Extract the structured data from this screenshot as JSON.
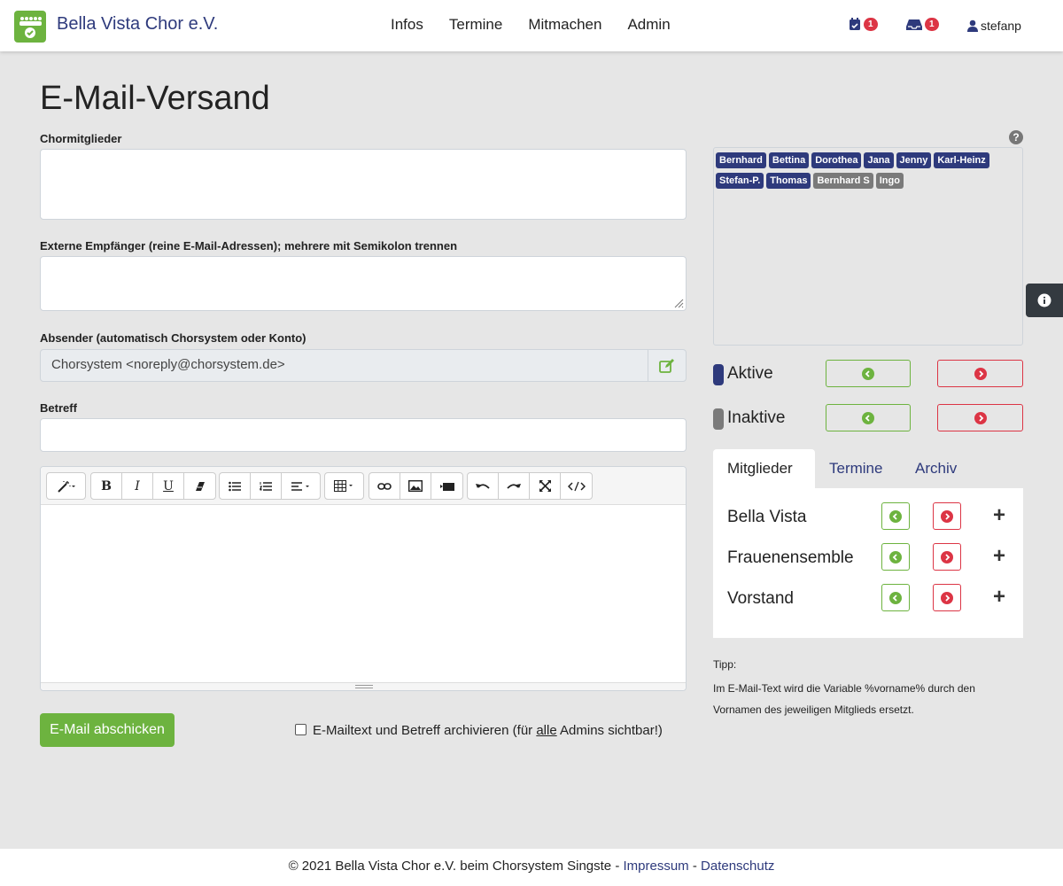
{
  "app": {
    "brand_name": "Bella Vista Chor e.V.",
    "brand_icon": "choir-people-check-icon",
    "colors": {
      "brand_green": "#6db33f",
      "brand_blue": "#2e3a7c",
      "danger": "#dc3545",
      "inactive_gray": "#7a7a7a"
    }
  },
  "nav": {
    "items": [
      {
        "label": "Infos"
      },
      {
        "label": "Termine"
      },
      {
        "label": "Mitmachen"
      },
      {
        "label": "Admin"
      }
    ],
    "calendar_badge": "1",
    "inbox_badge": "1",
    "user": "stefanp"
  },
  "page": {
    "title": "E-Mail-Versand"
  },
  "form": {
    "members_label": "Chormitglieder",
    "members_value": "",
    "external_label": "Externe Empfänger (reine E-Mail-Adressen); mehrere mit Semikolon trennen",
    "external_value": "",
    "sender_label": "Absender (automatisch Chorsystem oder Konto)",
    "sender_value": "Chorsystem <noreply@chorsystem.de>",
    "subject_label": "Betreff",
    "subject_value": "",
    "submit_label": "E-Mail abschicken",
    "archive_text_before": "E-Mailtext und Betreff archivieren (für ",
    "archive_text_underline": "alle",
    "archive_text_after": " Admins sichtbar!)",
    "archive_checked": false
  },
  "editor": {
    "toolbar": [
      [
        "magic-wand-icon"
      ],
      [
        "bold-icon",
        "italic-icon",
        "underline-icon",
        "eraser-icon"
      ],
      [
        "unordered-list-icon",
        "ordered-list-icon",
        "align-icon"
      ],
      [
        "table-icon"
      ],
      [
        "link-icon",
        "image-icon",
        "video-icon"
      ],
      [
        "undo-icon",
        "redo-icon",
        "fullscreen-icon",
        "code-view-icon"
      ]
    ],
    "content": ""
  },
  "recipients": {
    "tags": [
      {
        "name": "Bernhard",
        "status": "active"
      },
      {
        "name": "Bettina",
        "status": "active"
      },
      {
        "name": "Dorothea",
        "status": "active"
      },
      {
        "name": "Jana",
        "status": "active"
      },
      {
        "name": "Jenny",
        "status": "active"
      },
      {
        "name": "Karl-Heinz",
        "status": "active"
      },
      {
        "name": "Stefan-P.",
        "status": "active"
      },
      {
        "name": "Thomas",
        "status": "active"
      },
      {
        "name": "Bernhard S",
        "status": "inactive"
      },
      {
        "name": "Ingo",
        "status": "inactive"
      }
    ]
  },
  "status_filters": [
    {
      "label": "Aktive",
      "color": "#2e3a7c"
    },
    {
      "label": "Inaktive",
      "color": "#7a7a7a"
    }
  ],
  "tabs": [
    {
      "label": "Mitglieder",
      "active": true
    },
    {
      "label": "Termine",
      "active": false
    },
    {
      "label": "Archiv",
      "active": false
    }
  ],
  "groups": [
    {
      "name": "Bella Vista"
    },
    {
      "name": "Frauenensemble"
    },
    {
      "name": "Vorstand"
    }
  ],
  "tip": {
    "title": "Tipp:",
    "text": "Im E-Mail-Text wird die Variable %vorname% durch den Vornamen des jeweiligen Mitglieds ersetzt."
  },
  "footer": {
    "copyright": "© 2021 Bella Vista Chor e.V. beim Chorsystem Singste - ",
    "impressum": "Impressum",
    "separator": " - ",
    "datenschutz": "Datenschutz"
  }
}
